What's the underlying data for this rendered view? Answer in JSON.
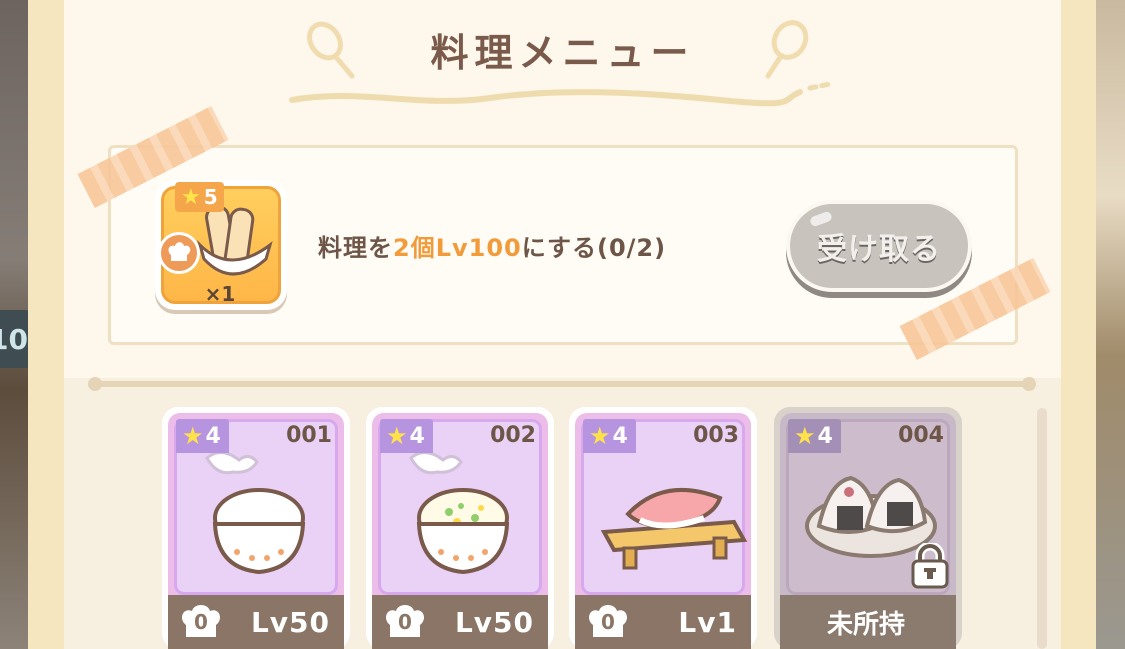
{
  "header": {
    "title": "料理メニュー"
  },
  "side": {
    "left_chip": "10"
  },
  "mission": {
    "text_prefix": "料理を",
    "text_highlight": "2個Lv100",
    "text_suffix": "にする(0/2)",
    "reward": {
      "rarity": "5",
      "count": "×1"
    },
    "claim_label": "受け取る",
    "claim_enabled": false
  },
  "recipes": [
    {
      "number": "001",
      "rarity": "4",
      "chef_count": "0",
      "level": "Lv50",
      "owned": true,
      "icon": "rice-bowl-icon"
    },
    {
      "number": "002",
      "rarity": "4",
      "chef_count": "0",
      "level": "Lv50",
      "owned": true,
      "icon": "fried-rice-icon"
    },
    {
      "number": "003",
      "rarity": "4",
      "chef_count": "0",
      "level": "Lv1",
      "owned": true,
      "icon": "sushi-icon"
    },
    {
      "number": "004",
      "rarity": "4",
      "chef_count": "",
      "level": "未所持",
      "owned": false,
      "icon": "onigiri-icon"
    }
  ],
  "colors": {
    "panel": "#fdf7ec",
    "accent_orange": "#f19b3a",
    "card_purple": "#ecbde9",
    "card_footer": "#8a7566",
    "title_brown": "#7a5a4a"
  }
}
